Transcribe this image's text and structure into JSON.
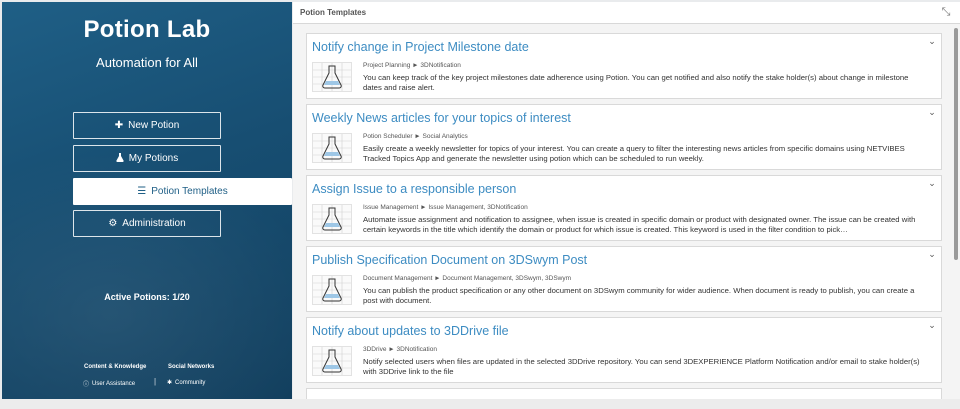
{
  "sidebar": {
    "app_title": "Potion Lab",
    "subtitle": "Automation for All",
    "nav": [
      {
        "label": "New Potion",
        "icon": "plus-icon"
      },
      {
        "label": "My Potions",
        "icon": "potion-icon"
      },
      {
        "label": "Potion Templates",
        "icon": "list-icon"
      },
      {
        "label": "Administration",
        "icon": "gear-icon"
      }
    ],
    "active_potions": "Active Potions: 1/20",
    "footer": {
      "col1_heading": "Content & Knowledge",
      "col2_heading": "Social Networks",
      "user_assistance": "User Assistance",
      "community": "Community",
      "separator": "|"
    }
  },
  "main": {
    "title": "Potion Templates",
    "cards": [
      {
        "title": "Notify change in Project Milestone date",
        "crumb": "Project Planning ► 3DNotification",
        "desc": "You can keep track of the key project milestones date adherence using Potion. You can get notified and also notify the stake holder(s) about change in milestone dates and raise alert."
      },
      {
        "title": "Weekly News articles for your topics of interest",
        "crumb": "Potion Scheduler ► Social Analytics",
        "desc": "Easily create a weekly newsletter for topics of your interest. You can create a query to filter the interesting news articles from specific domains using NETVIBES Tracked Topics App and generate the newsletter using potion which can be scheduled to run weekly."
      },
      {
        "title": "Assign Issue to a responsible person",
        "crumb": "Issue Management ► Issue Management, 3DNotification",
        "desc": "Automate issue assignment and notification to assignee, when issue is created in specific domain or product with designated owner. The issue can be created with certain keywords in the title which identify the domain or product for which issue is created. This keyword is used in the filter condition to pick…"
      },
      {
        "title": "Publish Specification Document on 3DSwym Post",
        "crumb": "Document Management ► Document Management, 3DSwym, 3DSwym",
        "desc": "You can publish the product specification or any other document on 3DSwym community for wider audience. When document is ready to publish, you can create a post with document."
      },
      {
        "title": "Notify about updates to 3DDrive file",
        "crumb": "3DDrive ► 3DNotification",
        "desc": "Notify selected users when files are updated in the selected 3DDrive repository. You can send 3DEXPERIENCE Platform Notification and/or email to stake holder(s) with 3DDrive link to the file"
      }
    ]
  },
  "colors": {
    "sidebar_bg": "#1f5f86",
    "link_blue": "#3d8cc2",
    "active_text": "#1f5f86"
  }
}
